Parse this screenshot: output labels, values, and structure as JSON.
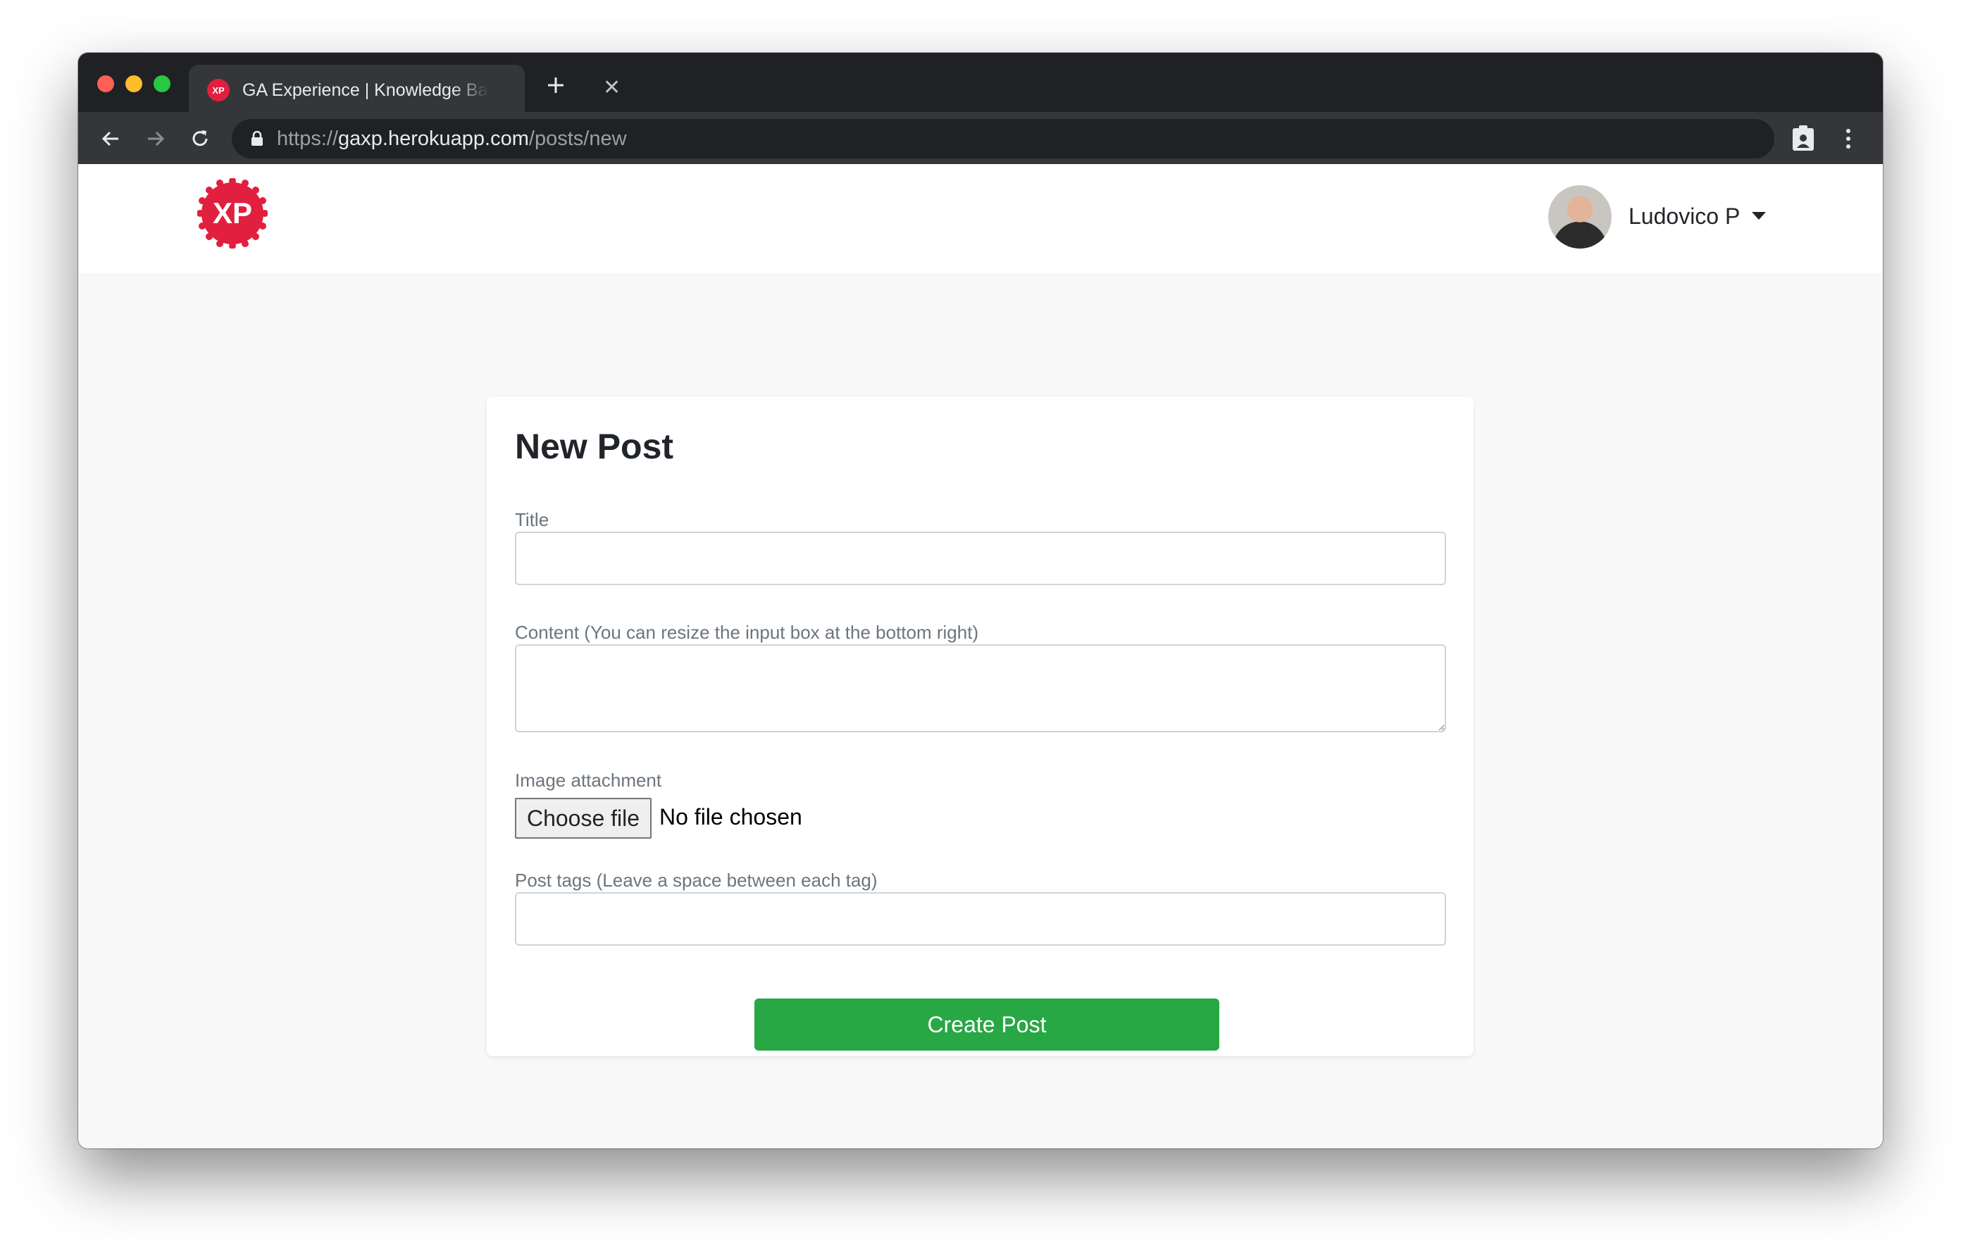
{
  "browser": {
    "tab_title": "GA Experience | Knowledge Base",
    "tab_favicon_text": "XP",
    "url_scheme": "https://",
    "url_host": "gaxp.herokuapp.com",
    "url_path": "/posts/new"
  },
  "navbar": {
    "logo_text": "XP",
    "user_name": "Ludovico P"
  },
  "form": {
    "heading": "New Post",
    "title_label": "Title",
    "title_value": "",
    "content_label": "Content (You can resize the input box at the bottom right)",
    "content_value": "",
    "image_label": "Image attachment",
    "file_button_label": "Choose file",
    "file_status": "No file chosen",
    "tags_label": "Post tags (Leave a space between each tag)",
    "tags_value": "",
    "submit_label": "Create Post"
  },
  "colors": {
    "brand_red": "#e11f3f",
    "submit_green": "#28a745",
    "titlebar": "#202124",
    "toolbar": "#35363a"
  },
  "icons": [
    "back-arrow-icon",
    "forward-arrow-icon",
    "reload-icon",
    "lock-icon",
    "clipboard-extension-icon",
    "more-vert-icon",
    "close-icon",
    "plus-icon",
    "chevron-down-icon"
  ]
}
